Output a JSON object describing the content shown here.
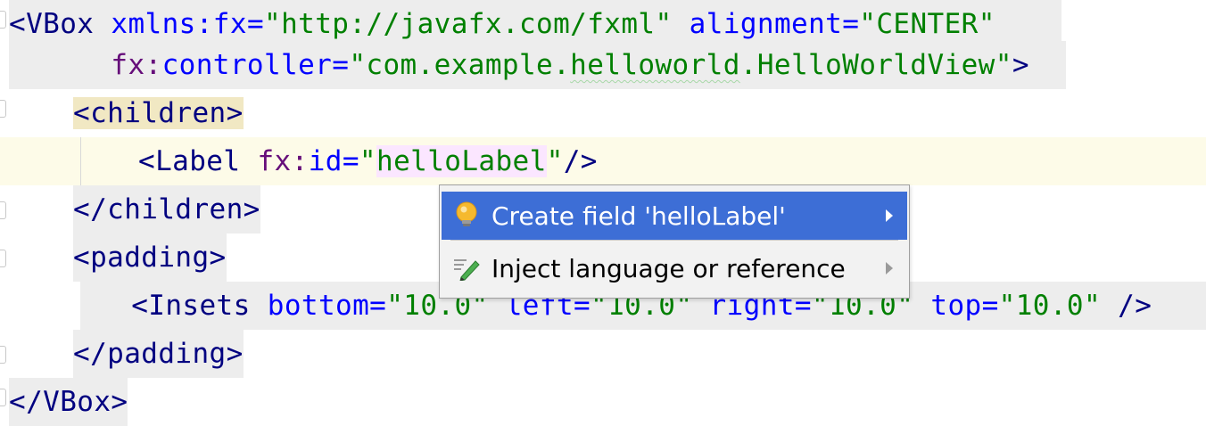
{
  "editor": {
    "lines": [
      {
        "open": "<",
        "tag": "VBox",
        "attr1": "xmlns:fx",
        "eq1": "=",
        "val1": "\"http://javafx.com/fxml\"",
        "attr2": "alignment",
        "eq2": "=",
        "val2": "\"CENTER\""
      },
      {
        "attr_ns": "fx",
        "attr_colon": ":",
        "attr_name": "controller",
        "eq": "=",
        "val_pre": "\"com.example.",
        "val_squiggle": "helloworld",
        "val_post": ".HelloWorldView\"",
        "close": ">"
      },
      {
        "text": "<children>",
        "open": "<",
        "tag": "children",
        "close": ">"
      },
      {
        "open": "<",
        "tag": "Label",
        "attr_ns": "fx",
        "attr_colon": ":",
        "attr_name": "id",
        "eq": "=",
        "q1": "\"",
        "val": "helloLabel",
        "q2": "\"",
        "close": "/>"
      },
      {
        "open": "</",
        "tag": "children",
        "close": ">"
      },
      {
        "open": "<",
        "tag": "padding",
        "close": ">"
      },
      {
        "open": "<",
        "tag": "Insets",
        "a1": "bottom",
        "v1": "\"10.0\"",
        "a2": "left",
        "v2": "\"10.0\"",
        "a3": "right",
        "v3": "\"10.0\"",
        "a4": "top",
        "v4": "\"10.0\"",
        "close": "/>"
      },
      {
        "open": "</",
        "tag": "padding",
        "close": ">"
      },
      {
        "open": "</",
        "tag": "VBox",
        "close": ">"
      }
    ]
  },
  "popup": {
    "items": [
      {
        "label": "Create field 'helloLabel'",
        "icon": "lightbulb-icon",
        "selected": true
      },
      {
        "label": "Inject language or reference",
        "icon": "pencil-icon",
        "selected": false
      }
    ]
  },
  "colors": {
    "tag": "#000080",
    "attribute": "#0000ff",
    "value": "#008000",
    "namespace": "#660e7a",
    "selection": "#3d6ed6"
  }
}
